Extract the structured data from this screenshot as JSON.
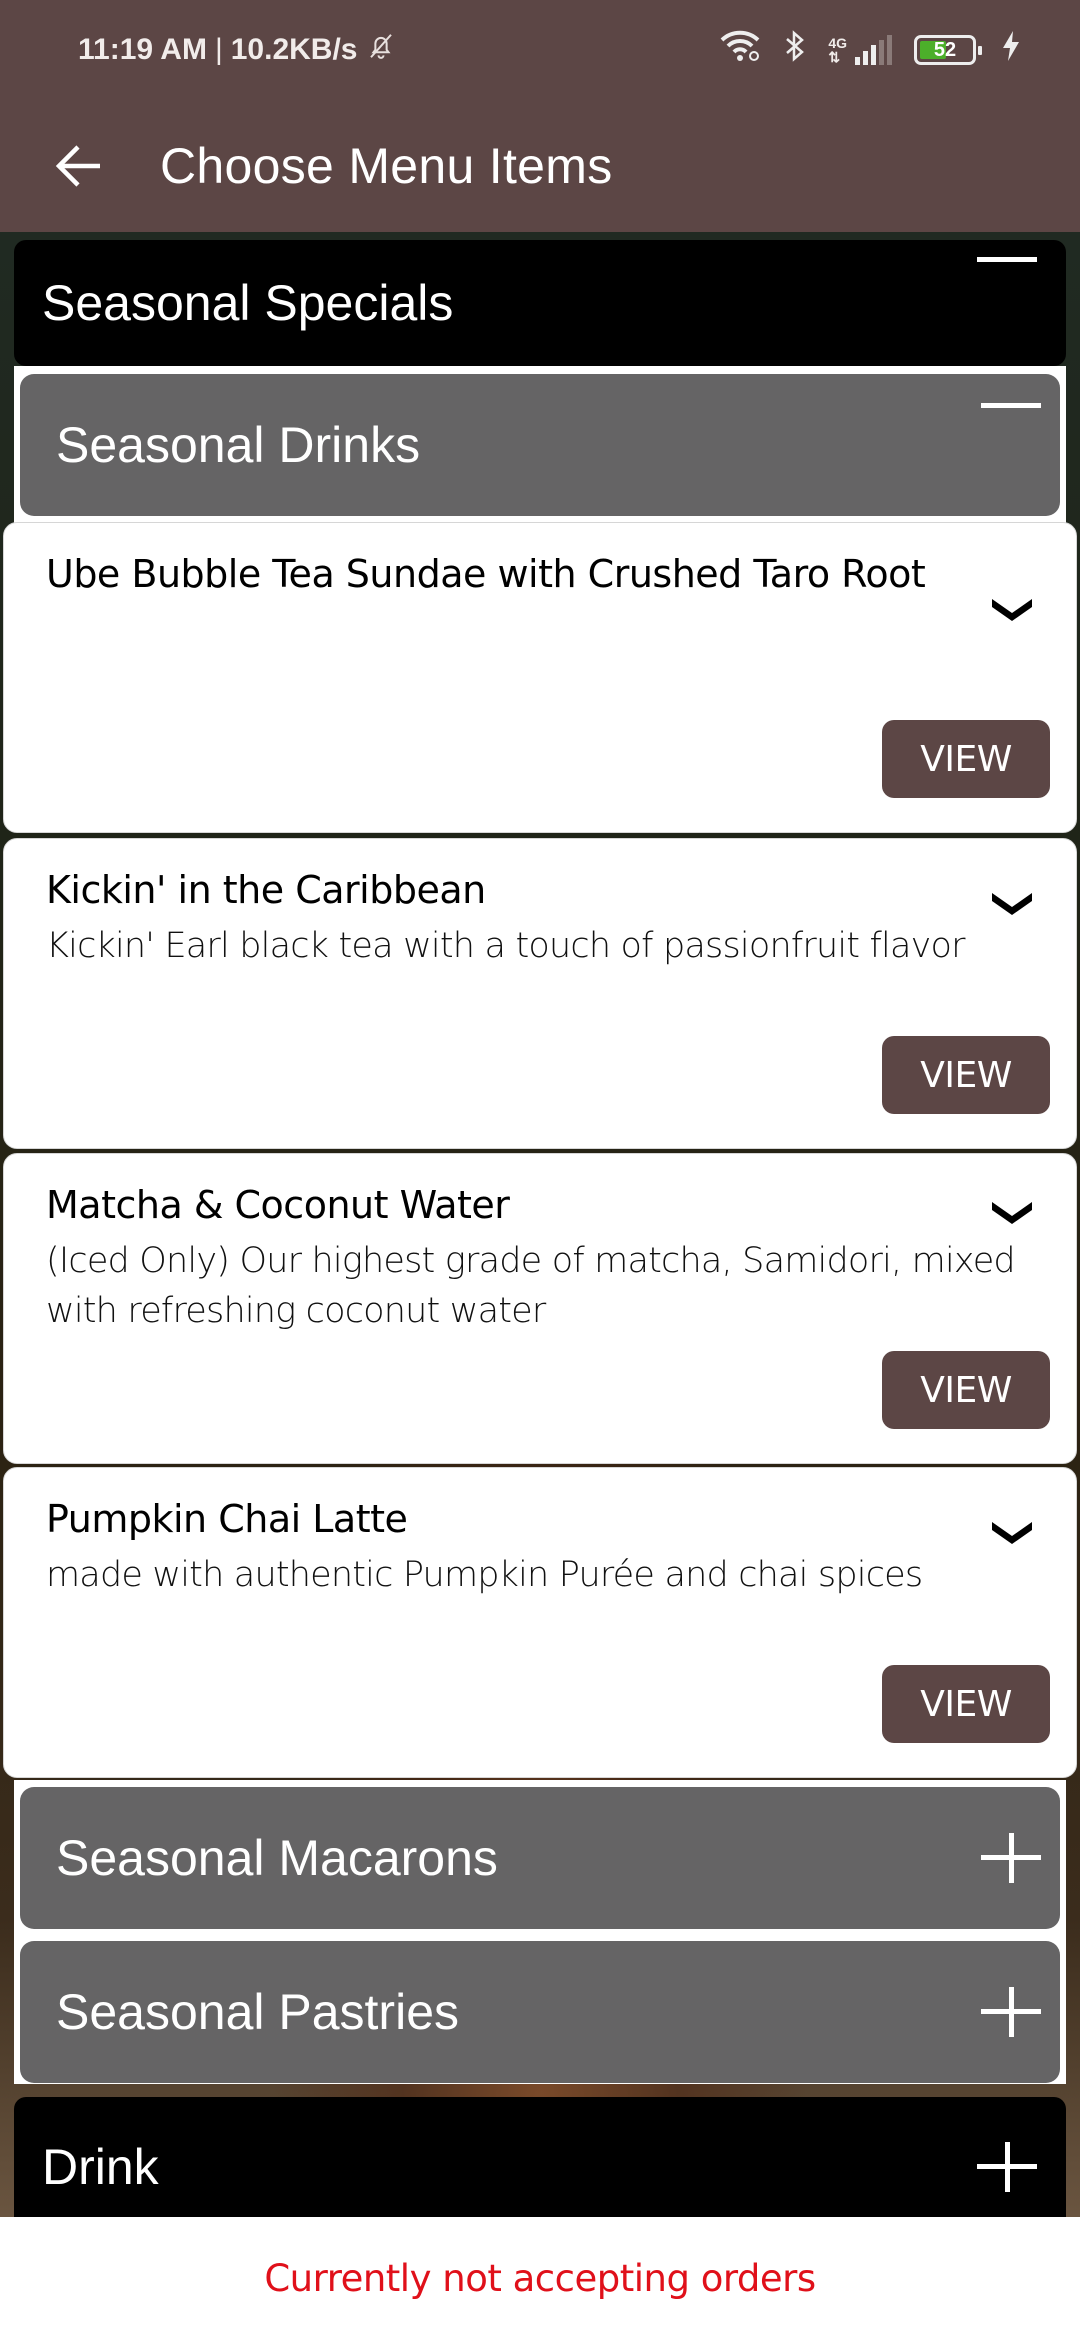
{
  "status_bar": {
    "time": "11:19 AM",
    "separator": "|",
    "net_speed": "10.2KB/s",
    "network_type": "4G",
    "battery_level": "52",
    "battery_percent": 52,
    "icons": [
      "mute-bell-icon",
      "wifi-icon",
      "bluetooth-icon",
      "signal-icon",
      "battery-icon",
      "charging-icon"
    ]
  },
  "app_bar": {
    "title": "Choose Menu Items",
    "back_icon": "arrow-left-icon"
  },
  "categories": [
    {
      "label": "Seasonal Specials",
      "expanded": true,
      "subcategories": [
        {
          "label": "Seasonal Drinks",
          "expanded": true,
          "items": [
            {
              "title": "Ube Bubble Tea Sundae with Crushed Taro Root",
              "description": "",
              "button_label": "VIEW"
            },
            {
              "title": "Kickin' in the Caribbean",
              "description": "Kickin' Earl black tea with a touch of passionfruit flavor",
              "button_label": "VIEW"
            },
            {
              "title": "Matcha & Coconut Water",
              "description": "(Iced Only) Our highest grade of matcha, Samidori, mixed with refreshing coconut water",
              "button_label": "VIEW"
            },
            {
              "title": "Pumpkin Chai Latte",
              "description": "made with authentic Pumpkin Purée and chai spices",
              "button_label": "VIEW"
            }
          ]
        },
        {
          "label": "Seasonal Macarons",
          "expanded": false
        },
        {
          "label": "Seasonal Pastries",
          "expanded": false
        }
      ]
    },
    {
      "label": "Drink",
      "expanded": false
    }
  ],
  "footer": {
    "message": "Currently not accepting orders",
    "message_color": "#e0101a"
  },
  "colors": {
    "brand": "#5c4645",
    "category_header": "#000000",
    "subcategory_header": "#656465"
  }
}
